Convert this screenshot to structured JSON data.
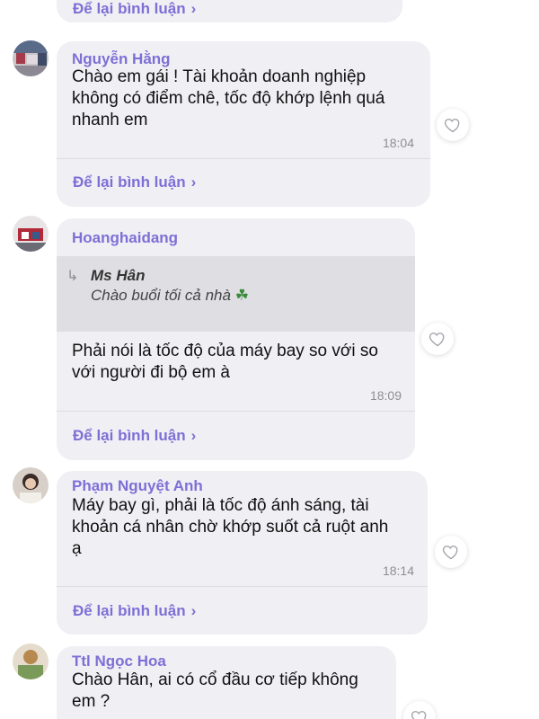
{
  "comments": [
    {
      "reply_label": "Để lại bình luận"
    },
    {
      "author": "Nguyễn Hằng",
      "lines": [
        "Chào em gái ! Tài khoản doanh nghiệp",
        "không có điểm chê, tốc độ khớp lệnh quá",
        "nhanh em"
      ],
      "time": "18:04",
      "reply_label": "Để lại bình luận"
    },
    {
      "author": "Hoanghaidang",
      "quote": {
        "author": "Ms Hân",
        "text": "Chào buổi tối cả nhà",
        "emoji": "☘"
      },
      "lines": [
        "Phải nói là tốc độ của máy bay so với so",
        "với người đi bộ em à"
      ],
      "time": "18:09",
      "reply_label": "Để lại bình luận"
    },
    {
      "author": "Phạm Nguyệt Anh",
      "lines": [
        "Máy bay gì, phải là tốc độ ánh sáng, tài",
        "khoản cá nhân chờ khớp suốt cả ruột anh",
        "ạ"
      ],
      "time": "18:14",
      "reply_label": "Để lại bình luận"
    },
    {
      "author": "Ttl Ngọc Hoa",
      "lines": [
        "Chào Hân, ai có cổ đầu cơ tiếp không",
        "em ?"
      ]
    }
  ],
  "icons": {
    "like": "heart-outline-icon",
    "reply_arrow": "reply-arrow-icon",
    "chevron": "chevron-right-icon"
  },
  "colors": {
    "accent": "#7e6fd6",
    "bubble": "#efeff4",
    "quote_bg": "#dedee3"
  }
}
